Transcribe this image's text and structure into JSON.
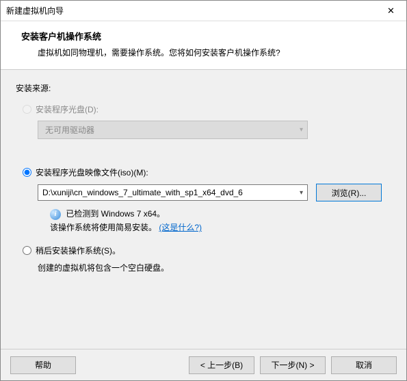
{
  "window": {
    "title": "新建虚拟机向导",
    "close": "✕"
  },
  "header": {
    "title": "安装客户机操作系统",
    "subtitle": "虚拟机如同物理机，需要操作系统。您将如何安装客户机操作系统?"
  },
  "sourceLabel": "安装来源:",
  "optDisc": {
    "label": "安装程序光盘(D):",
    "combo": "无可用驱动器"
  },
  "optIso": {
    "label": "安装程序光盘映像文件(iso)(M):",
    "path": "D:\\xuniji\\cn_windows_7_ultimate_with_sp1_x64_dvd_6",
    "browse": "浏览(R)..."
  },
  "info": {
    "detected": "已检测到 Windows 7 x64。",
    "easyPrefix": "该操作系统将使用简易安装。",
    "linkText": "(这是什么?)"
  },
  "optLater": {
    "label": "稍后安装操作系统(S)。",
    "note": "创建的虚拟机将包含一个空白硬盘。"
  },
  "footer": {
    "help": "帮助",
    "back": "< 上一步(B)",
    "next": "下一步(N) >",
    "cancel": "取消"
  }
}
